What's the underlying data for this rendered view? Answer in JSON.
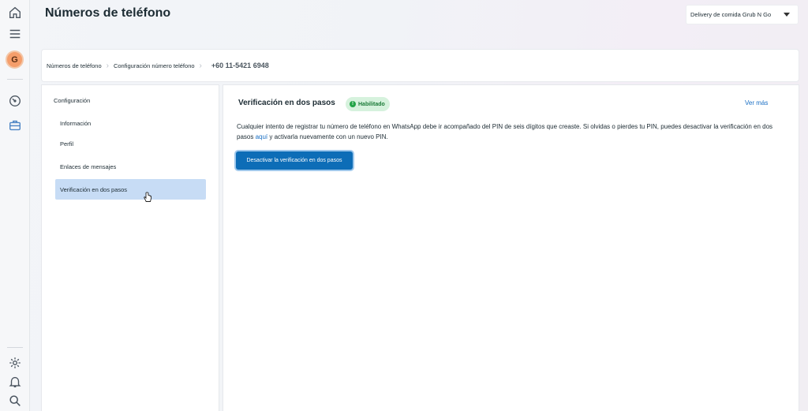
{
  "header": {
    "title": "Números de teléfono",
    "account_selector": "Delivery de comida Grub N Go"
  },
  "rail": {
    "avatar_letter": "G",
    "top_icons": [
      "home-icon",
      "menu-icon"
    ],
    "middle_icons": [
      "gauge-icon",
      "briefcase-icon"
    ],
    "bottom_icons": [
      "gear-icon",
      "bell-icon",
      "search-icon"
    ]
  },
  "breadcrumb": {
    "items": [
      "Números de teléfono",
      "Configuración número teléfono"
    ],
    "current": "+60 11-5421 6948"
  },
  "nav": {
    "group": "Configuración",
    "items": [
      {
        "label": "Información",
        "active": false
      },
      {
        "label": "Perfil",
        "active": false
      },
      {
        "label": "Enlaces de mensajes",
        "active": false
      },
      {
        "label": "Verificación en dos pasos",
        "active": true
      }
    ]
  },
  "main": {
    "title": "Verificación en dos pasos",
    "badge": "Habilitado",
    "see_more": "Ver más",
    "description_part1": "Cualquier intento de registrar tu número de teléfono en WhatsApp debe ir acompañado del PIN de seis dígitos que creaste. Si olvidas o pierdes tu PIN, puedes desactivar la verificación en dos pasos ",
    "description_link": "aquí",
    "description_part2": " y activarla nuevamente con un nuevo PIN.",
    "button_label": "Desactivar la verificación en dos pasos"
  },
  "colors": {
    "accent": "#0d6db7",
    "link": "#1a6fc4",
    "badge_bg": "#d6f2dd",
    "badge_text": "#1a7a37",
    "nav_active": "#c7dcf5"
  }
}
